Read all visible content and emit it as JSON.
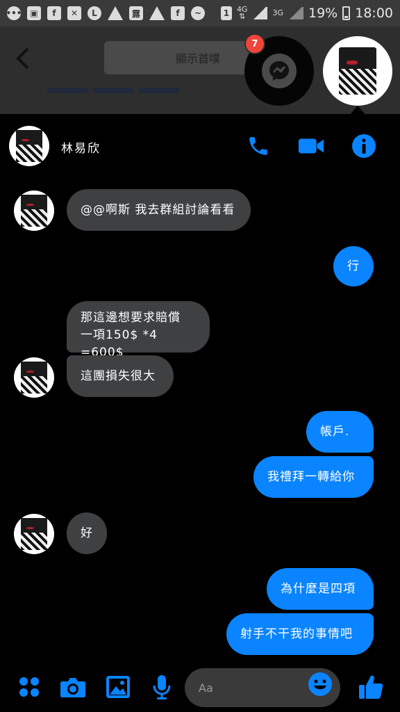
{
  "status_bar": {
    "network_4g": "4G",
    "network_3g": "3G",
    "sim_label": "1",
    "battery": "19%",
    "time": "18:00"
  },
  "background_page": {
    "button_label": "顯示首噗"
  },
  "chat_heads": {
    "messenger_badge": "7"
  },
  "chat": {
    "contact_name": "林易欣",
    "messages": [
      {
        "side": "in",
        "text": "@@啊斯 我去群組討論看看"
      },
      {
        "side": "out",
        "text": "行"
      },
      {
        "side": "in",
        "line1": "那這邊想要求賠償",
        "line2": "一項150$ *4 =600$"
      },
      {
        "side": "in",
        "text": "這團損失很大"
      },
      {
        "side": "out",
        "text": "帳戶."
      },
      {
        "side": "out",
        "text": "我禮拜一轉給你"
      },
      {
        "side": "in",
        "text": "好"
      },
      {
        "side": "out",
        "text": "為什麼是四項"
      },
      {
        "side": "out",
        "text": "射手不干我的事情吧"
      }
    ],
    "composer_placeholder": "Aa"
  },
  "colors": {
    "accent": "#0a84ff",
    "incoming_bubble": "#3e4042",
    "badge": "#f0453a"
  },
  "icons": [
    "phone-icon",
    "video-icon",
    "info-icon",
    "apps-icon",
    "camera-icon",
    "gallery-icon",
    "microphone-icon",
    "emoji-icon",
    "thumbs-up-icon",
    "messenger-icon",
    "back-arrow-icon"
  ]
}
